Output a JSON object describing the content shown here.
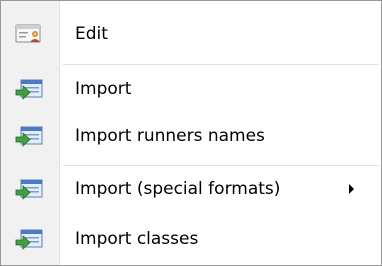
{
  "menu": {
    "items": [
      {
        "label": "Edit",
        "icon": "edit-card-icon"
      },
      {
        "label": "Import",
        "icon": "import-icon"
      },
      {
        "label": "Import runners names",
        "icon": "import-icon"
      },
      {
        "label": "Import (special formats)",
        "icon": "import-icon",
        "submenu_arrow": "submenu-arrow-icon"
      },
      {
        "label": "Import classes",
        "icon": "import-icon"
      }
    ]
  }
}
